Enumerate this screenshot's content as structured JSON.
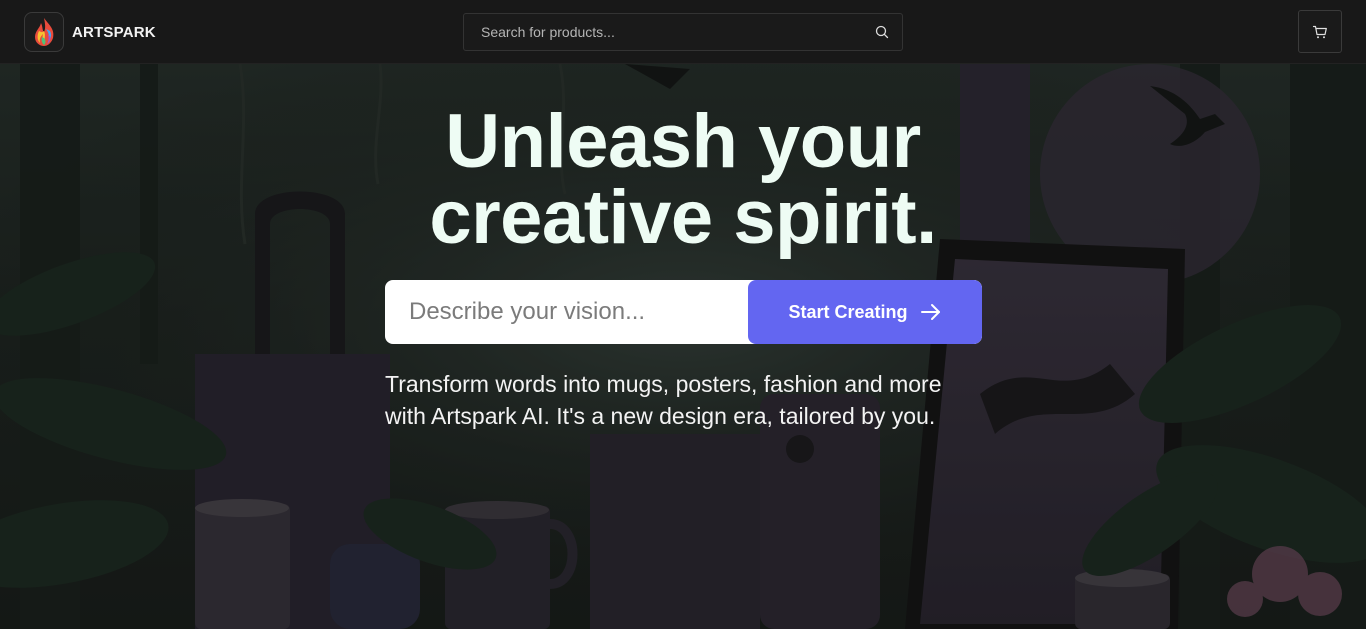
{
  "header": {
    "brand_name": "ARTSPARK",
    "logo_icon": "flame-logo-icon",
    "search": {
      "placeholder": "Search for products...",
      "value": ""
    },
    "search_icon": "search-icon",
    "cart_icon": "cart-icon"
  },
  "hero": {
    "title_line1": "Unleash your",
    "title_line2": "creative spirit.",
    "vision_input": {
      "placeholder": "Describe your vision...",
      "value": ""
    },
    "cta_label": "Start Creating",
    "cta_icon": "arrow-right-icon",
    "subtitle": "Transform words into mugs, posters, fashion and more with Artspark AI. It's a new design era, tailored by you."
  },
  "colors": {
    "topbar_bg": "#181818",
    "accent": "#6366f1",
    "title_text": "#eefcf4"
  }
}
